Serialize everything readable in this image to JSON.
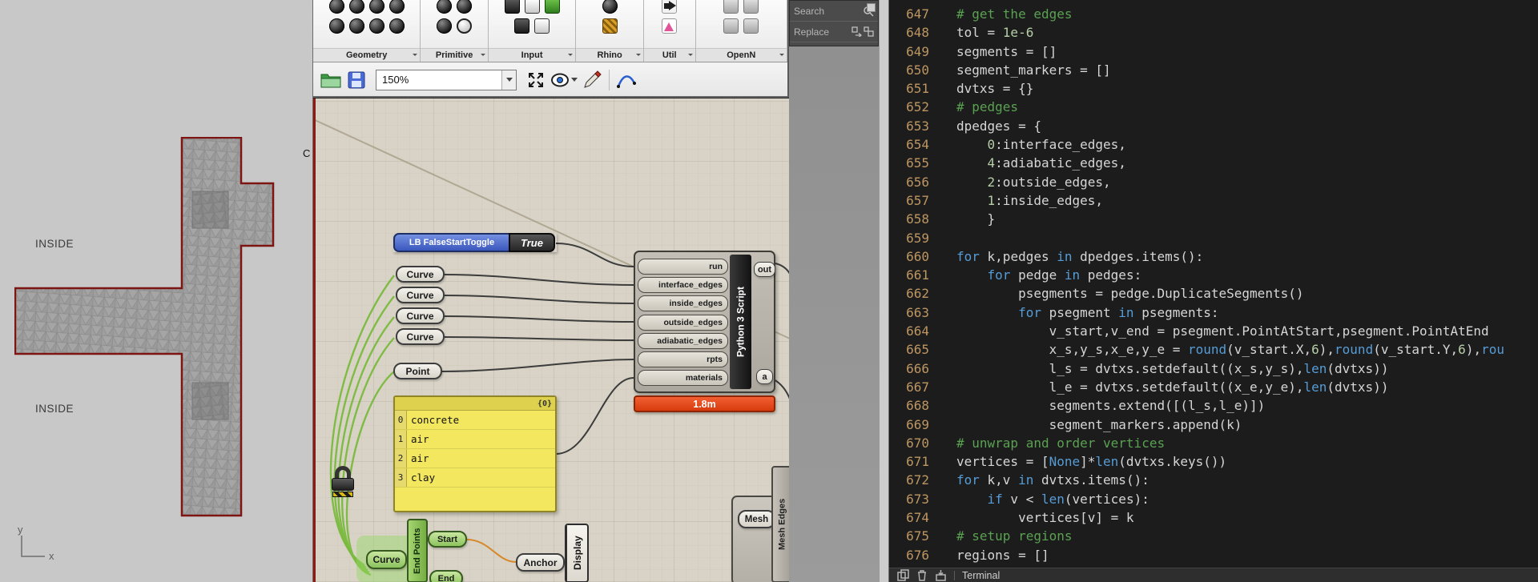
{
  "colors": {
    "wire_green": "#7ab93e",
    "error_red": "#d63b0d",
    "toggle_blue": "#3a57bd",
    "panel_yellow": "#f3e75f",
    "selection_green": "#8cc45e",
    "code_background": "#1c1c1c",
    "keyword_blue": "#569cd6",
    "comment_green": "#5aa152",
    "number_green": "#b5cea8",
    "line_number_gold": "#bd9662"
  },
  "rhino_viewport": {
    "labels": {
      "inside_top": "INSIDE",
      "inside_bottom": "INSIDE",
      "partial": "C"
    },
    "axis": {
      "x": "x",
      "y": "y"
    }
  },
  "grasshopper": {
    "tab_bar": {
      "tabs": [
        {
          "label": "Geometry",
          "icon_rows": [
            [
              "dc",
              "dc",
              "dc",
              "dc"
            ],
            [
              "dc",
              "dc",
              "dc",
              "dc"
            ]
          ]
        },
        {
          "label": "Primitive",
          "icon_rows": [
            [
              "dc",
              "dc"
            ],
            [
              "dc",
              "wc"
            ]
          ]
        },
        {
          "label": "Input",
          "icon_rows": [
            [
              "ds",
              "ws",
              "gs"
            ],
            [
              "ds",
              "ws"
            ]
          ]
        },
        {
          "label": "Rhino",
          "icon_rows": [
            [
              "dc"
            ],
            [
              "ys"
            ]
          ]
        },
        {
          "label": "Util",
          "icon_rows": [
            [
              "ar"
            ],
            [
              "fl"
            ]
          ]
        },
        {
          "label": "OpenN",
          "icon_rows": [
            [
              "gr",
              "gr"
            ],
            [
              "gr",
              "gr"
            ]
          ]
        }
      ]
    },
    "toolbar": {
      "zoom": "150%"
    },
    "components": {
      "toggle": {
        "label": "LB FalseStartToggle",
        "value": "True"
      },
      "curve_params": [
        "Curve",
        "Curve",
        "Curve",
        "Curve"
      ],
      "point": "Point",
      "panel": {
        "header": "{0}",
        "rows": [
          [
            "0",
            "concrete"
          ],
          [
            "1",
            "air"
          ],
          [
            "2",
            "air"
          ],
          [
            "3",
            "clay"
          ]
        ]
      },
      "python": {
        "name": "Python 3 Script",
        "inputs": [
          "run",
          "interface_edges",
          "inside_edges",
          "outside_edges",
          "adiabatic_edges",
          "rpts",
          "materials"
        ],
        "outputs": [
          "out",
          "a"
        ],
        "runtime_message": "1.8m"
      },
      "endpoints": {
        "name": "End Points",
        "input": "Curve",
        "outputs": [
          "Start",
          "End"
        ]
      },
      "display": {
        "name": "Display",
        "input": "Anchor"
      },
      "mesh_edges": {
        "name": "Mesh Edges",
        "input": "Mesh"
      }
    }
  },
  "search_overlay": {
    "search_label": "Search",
    "replace_label": "Replace"
  },
  "code_editor": {
    "terminal_label": "Terminal",
    "lines": [
      {
        "n": 647,
        "t": [
          [
            "c",
            "# get the edges"
          ]
        ]
      },
      {
        "n": 648,
        "t": [
          [
            "p",
            "tol = "
          ],
          [
            "n",
            "1e-6"
          ]
        ]
      },
      {
        "n": 649,
        "t": [
          [
            "p",
            "segments = []"
          ]
        ]
      },
      {
        "n": 650,
        "t": [
          [
            "p",
            "segment_markers = []"
          ]
        ]
      },
      {
        "n": 651,
        "t": [
          [
            "p",
            "dvtxs = {}"
          ]
        ]
      },
      {
        "n": 652,
        "t": [
          [
            "c",
            "# pedges"
          ]
        ]
      },
      {
        "n": 653,
        "t": [
          [
            "p",
            "dpedges = {"
          ]
        ]
      },
      {
        "n": 654,
        "t": [
          [
            "p",
            "    "
          ],
          [
            "n",
            "0"
          ],
          [
            "p",
            ":interface_edges,"
          ]
        ]
      },
      {
        "n": 655,
        "t": [
          [
            "p",
            "    "
          ],
          [
            "n",
            "4"
          ],
          [
            "p",
            ":adiabatic_edges,"
          ]
        ]
      },
      {
        "n": 656,
        "t": [
          [
            "p",
            "    "
          ],
          [
            "n",
            "2"
          ],
          [
            "p",
            ":outside_edges,"
          ]
        ]
      },
      {
        "n": 657,
        "t": [
          [
            "p",
            "    "
          ],
          [
            "n",
            "1"
          ],
          [
            "p",
            ":inside_edges,"
          ]
        ]
      },
      {
        "n": 658,
        "t": [
          [
            "p",
            "    }"
          ]
        ]
      },
      {
        "n": 659,
        "t": []
      },
      {
        "n": 660,
        "t": [
          [
            "k",
            "for"
          ],
          [
            "p",
            " k,pedges "
          ],
          [
            "k",
            "in"
          ],
          [
            "p",
            " dpedges.items():"
          ]
        ]
      },
      {
        "n": 661,
        "t": [
          [
            "p",
            "    "
          ],
          [
            "k",
            "for"
          ],
          [
            "p",
            " pedge "
          ],
          [
            "k",
            "in"
          ],
          [
            "p",
            " pedges:"
          ]
        ]
      },
      {
        "n": 662,
        "t": [
          [
            "p",
            "        psegments = pedge.DuplicateSegments()"
          ]
        ]
      },
      {
        "n": 663,
        "t": [
          [
            "p",
            "        "
          ],
          [
            "k",
            "for"
          ],
          [
            "p",
            " psegment "
          ],
          [
            "k",
            "in"
          ],
          [
            "p",
            " psegments:"
          ]
        ]
      },
      {
        "n": 664,
        "t": [
          [
            "p",
            "            v_start,v_end = psegment.PointAtStart,psegment.PointAtEnd"
          ]
        ]
      },
      {
        "n": 665,
        "t": [
          [
            "p",
            "            x_s,y_s,x_e,y_e = "
          ],
          [
            "b",
            "round"
          ],
          [
            "p",
            "(v_start.X,"
          ],
          [
            "n",
            "6"
          ],
          [
            "p",
            "),"
          ],
          [
            "b",
            "round"
          ],
          [
            "p",
            "(v_start.Y,"
          ],
          [
            "n",
            "6"
          ],
          [
            "p",
            "),"
          ],
          [
            "b",
            "rou"
          ]
        ]
      },
      {
        "n": 666,
        "t": [
          [
            "p",
            "            l_s = dvtxs.setdefault((x_s,y_s),"
          ],
          [
            "b",
            "len"
          ],
          [
            "p",
            "(dvtxs))"
          ]
        ]
      },
      {
        "n": 667,
        "t": [
          [
            "p",
            "            l_e = dvtxs.setdefault((x_e,y_e),"
          ],
          [
            "b",
            "len"
          ],
          [
            "p",
            "(dvtxs))"
          ]
        ]
      },
      {
        "n": 668,
        "t": [
          [
            "p",
            "            segments.extend([(l_s,l_e)])"
          ]
        ]
      },
      {
        "n": 669,
        "t": [
          [
            "p",
            "            segment_markers.append(k)"
          ]
        ]
      },
      {
        "n": 670,
        "t": [
          [
            "c",
            "# unwrap and order vertices"
          ]
        ]
      },
      {
        "n": 671,
        "t": [
          [
            "p",
            "vertices = ["
          ],
          [
            "k",
            "None"
          ],
          [
            "p",
            "]*"
          ],
          [
            "b",
            "len"
          ],
          [
            "p",
            "(dvtxs.keys())"
          ]
        ]
      },
      {
        "n": 672,
        "t": [
          [
            "k",
            "for"
          ],
          [
            "p",
            " k,v "
          ],
          [
            "k",
            "in"
          ],
          [
            "p",
            " dvtxs.items():"
          ]
        ]
      },
      {
        "n": 673,
        "t": [
          [
            "p",
            "    "
          ],
          [
            "k",
            "if"
          ],
          [
            "p",
            " v < "
          ],
          [
            "b",
            "len"
          ],
          [
            "p",
            "(vertices):"
          ]
        ]
      },
      {
        "n": 674,
        "t": [
          [
            "p",
            "        vertices[v] = k"
          ]
        ]
      },
      {
        "n": 675,
        "t": [
          [
            "c",
            "# setup regions"
          ]
        ]
      },
      {
        "n": 676,
        "t": [
          [
            "p",
            "regions = []"
          ]
        ]
      }
    ]
  }
}
